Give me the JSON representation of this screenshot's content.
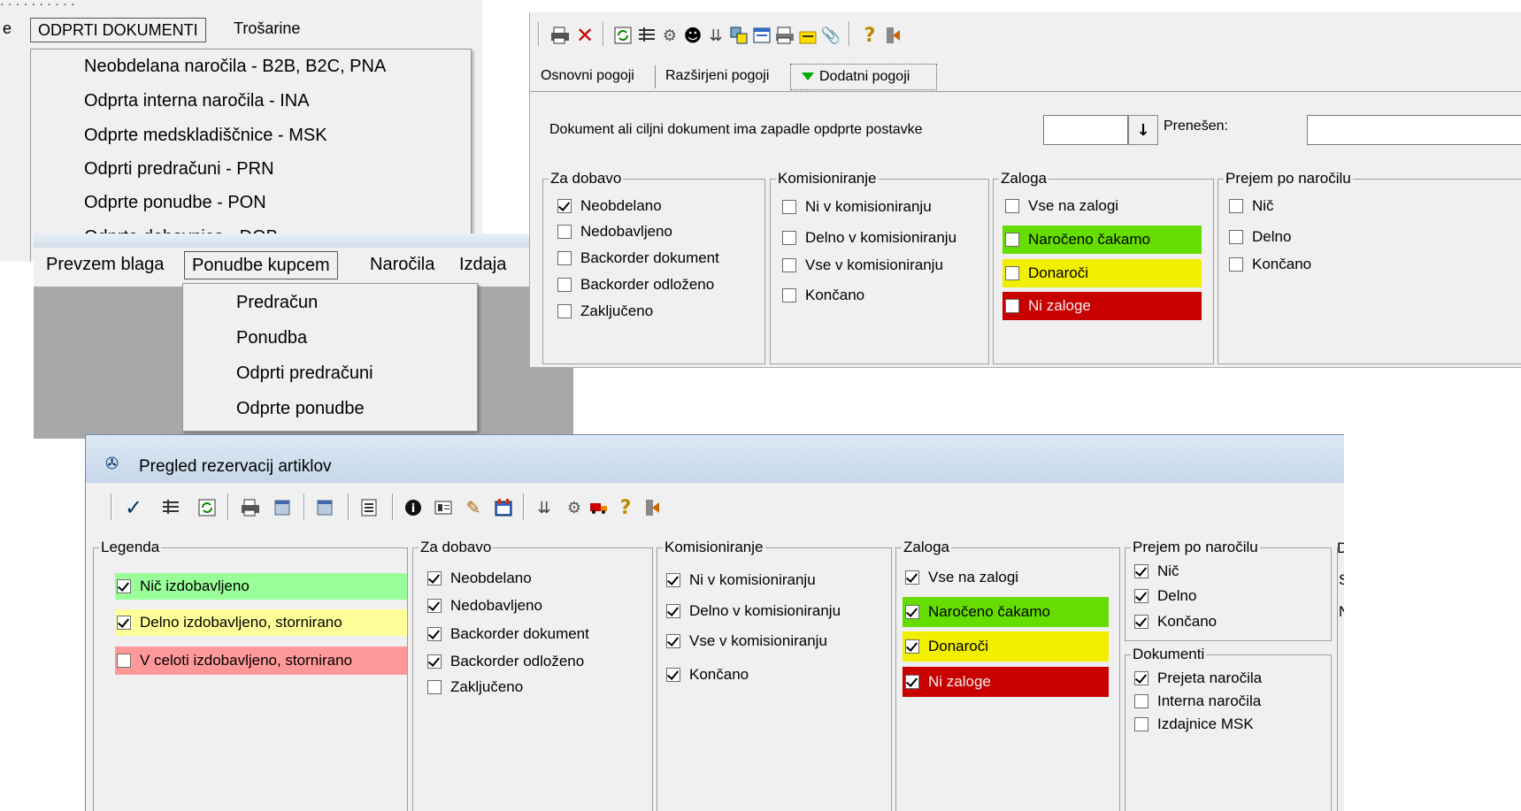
{
  "menu1": {
    "prev_fragment": "e",
    "active": "ODPRTI DOKUMENTI",
    "next": "Trošarine",
    "items": [
      "Neobdelana naročila - B2B, B2C, PNA",
      "Odprta interna naročila - INA",
      "Odprte medskladiščnice - MSK",
      "Odprti predračuni - PRN",
      "Odprte ponudbe - PON",
      "Odprte dobavnice - DOB"
    ]
  },
  "menu2": {
    "bar": [
      "Prevzem blaga",
      "Ponudbe kupcem",
      "Naročila",
      "Izdaja"
    ],
    "items": [
      "Predračun",
      "Ponudba",
      "Odprti predračuni",
      "Odprte ponudbe"
    ]
  },
  "filter": {
    "tabs": [
      "Osnovni pogoji",
      "Razširjeni pogoji",
      "Dodatni pogoji"
    ],
    "doc_label": "Dokument ali ciljni dokument ima zapadle opdprte postavke",
    "transferred_label": "Prenešen:",
    "za_dobavo": {
      "title": "Za dobavo",
      "items": [
        {
          "label": "Neobdelano",
          "checked": true
        },
        {
          "label": "Nedobavljeno",
          "checked": false
        },
        {
          "label": "Backorder dokument",
          "checked": false
        },
        {
          "label": "Backorder odloženo",
          "checked": false
        },
        {
          "label": "Zaključeno",
          "checked": false
        }
      ]
    },
    "komisioniranje": {
      "title": "Komisioniranje",
      "items": [
        {
          "label": "Ni v komisioniranju",
          "checked": false
        },
        {
          "label": "Delno v komisioniranju",
          "checked": false
        },
        {
          "label": "Vse  v komisioniranju",
          "checked": false
        },
        {
          "label": "Končano",
          "checked": false
        }
      ]
    },
    "zaloga": {
      "title": "Zaloga",
      "items": [
        {
          "label": "Vse na zalogi",
          "checked": false
        },
        {
          "label": "Naročeno čakamo",
          "checked": false
        },
        {
          "label": "Donaroči",
          "checked": false
        },
        {
          "label": "Ni zaloge",
          "checked": false
        }
      ]
    },
    "prejem": {
      "title": "Prejem po naročilu",
      "items": [
        {
          "label": "Nič",
          "checked": false
        },
        {
          "label": "Delno",
          "checked": false
        },
        {
          "label": "Končano",
          "checked": false
        }
      ]
    }
  },
  "reservations": {
    "title": "Pregled rezervacij artiklov",
    "legenda": {
      "title": "Legenda",
      "items": [
        {
          "label": "Nič izdobavljeno",
          "checked": true
        },
        {
          "label": "Delno izdobavljeno, stornirano",
          "checked": true
        },
        {
          "label": "V celoti izdobavljeno, stornirano",
          "checked": false
        }
      ]
    },
    "za_dobavo": {
      "title": "Za dobavo",
      "items": [
        {
          "label": "Neobdelano",
          "checked": true
        },
        {
          "label": "Nedobavljeno",
          "checked": true
        },
        {
          "label": "Backorder dokument",
          "checked": true
        },
        {
          "label": "Backorder odloženo",
          "checked": true
        },
        {
          "label": "Zaključeno",
          "checked": false
        }
      ]
    },
    "komisioniranje": {
      "title": "Komisioniranje",
      "items": [
        {
          "label": "Ni v komisioniranju",
          "checked": true
        },
        {
          "label": "Delno v komisioniranju",
          "checked": true
        },
        {
          "label": "Vse v komisioniranju",
          "checked": true
        },
        {
          "label": "Končano",
          "checked": true
        }
      ]
    },
    "zaloga": {
      "title": "Zaloga",
      "items": [
        {
          "label": "Vse na zalogi",
          "checked": true
        },
        {
          "label": "Naročeno čakamo",
          "checked": true
        },
        {
          "label": "Donaroči",
          "checked": true
        },
        {
          "label": "Ni zaloge",
          "checked": true
        }
      ]
    },
    "prejem": {
      "title": "Prejem po naročilu",
      "items": [
        {
          "label": "Nič",
          "checked": true
        },
        {
          "label": "Delno",
          "checked": true
        },
        {
          "label": "Končano",
          "checked": true
        }
      ]
    },
    "dokumenti": {
      "title": "Dokumenti",
      "items": [
        {
          "label": "Prejeta naročila",
          "checked": true
        },
        {
          "label": "Interna naročila",
          "checked": false
        },
        {
          "label": "Izdajnice MSK",
          "checked": false
        }
      ]
    },
    "cut_letters": [
      "D",
      "S",
      "N"
    ]
  },
  "colors": {
    "green_strong": "#66dd00",
    "yellow": "#f2ee00",
    "red": "#c80000",
    "legend_green": "#99ff99",
    "legend_yellow": "#ffff99",
    "legend_red": "#ff9999",
    "panel_bg": "#f0f0f0"
  }
}
